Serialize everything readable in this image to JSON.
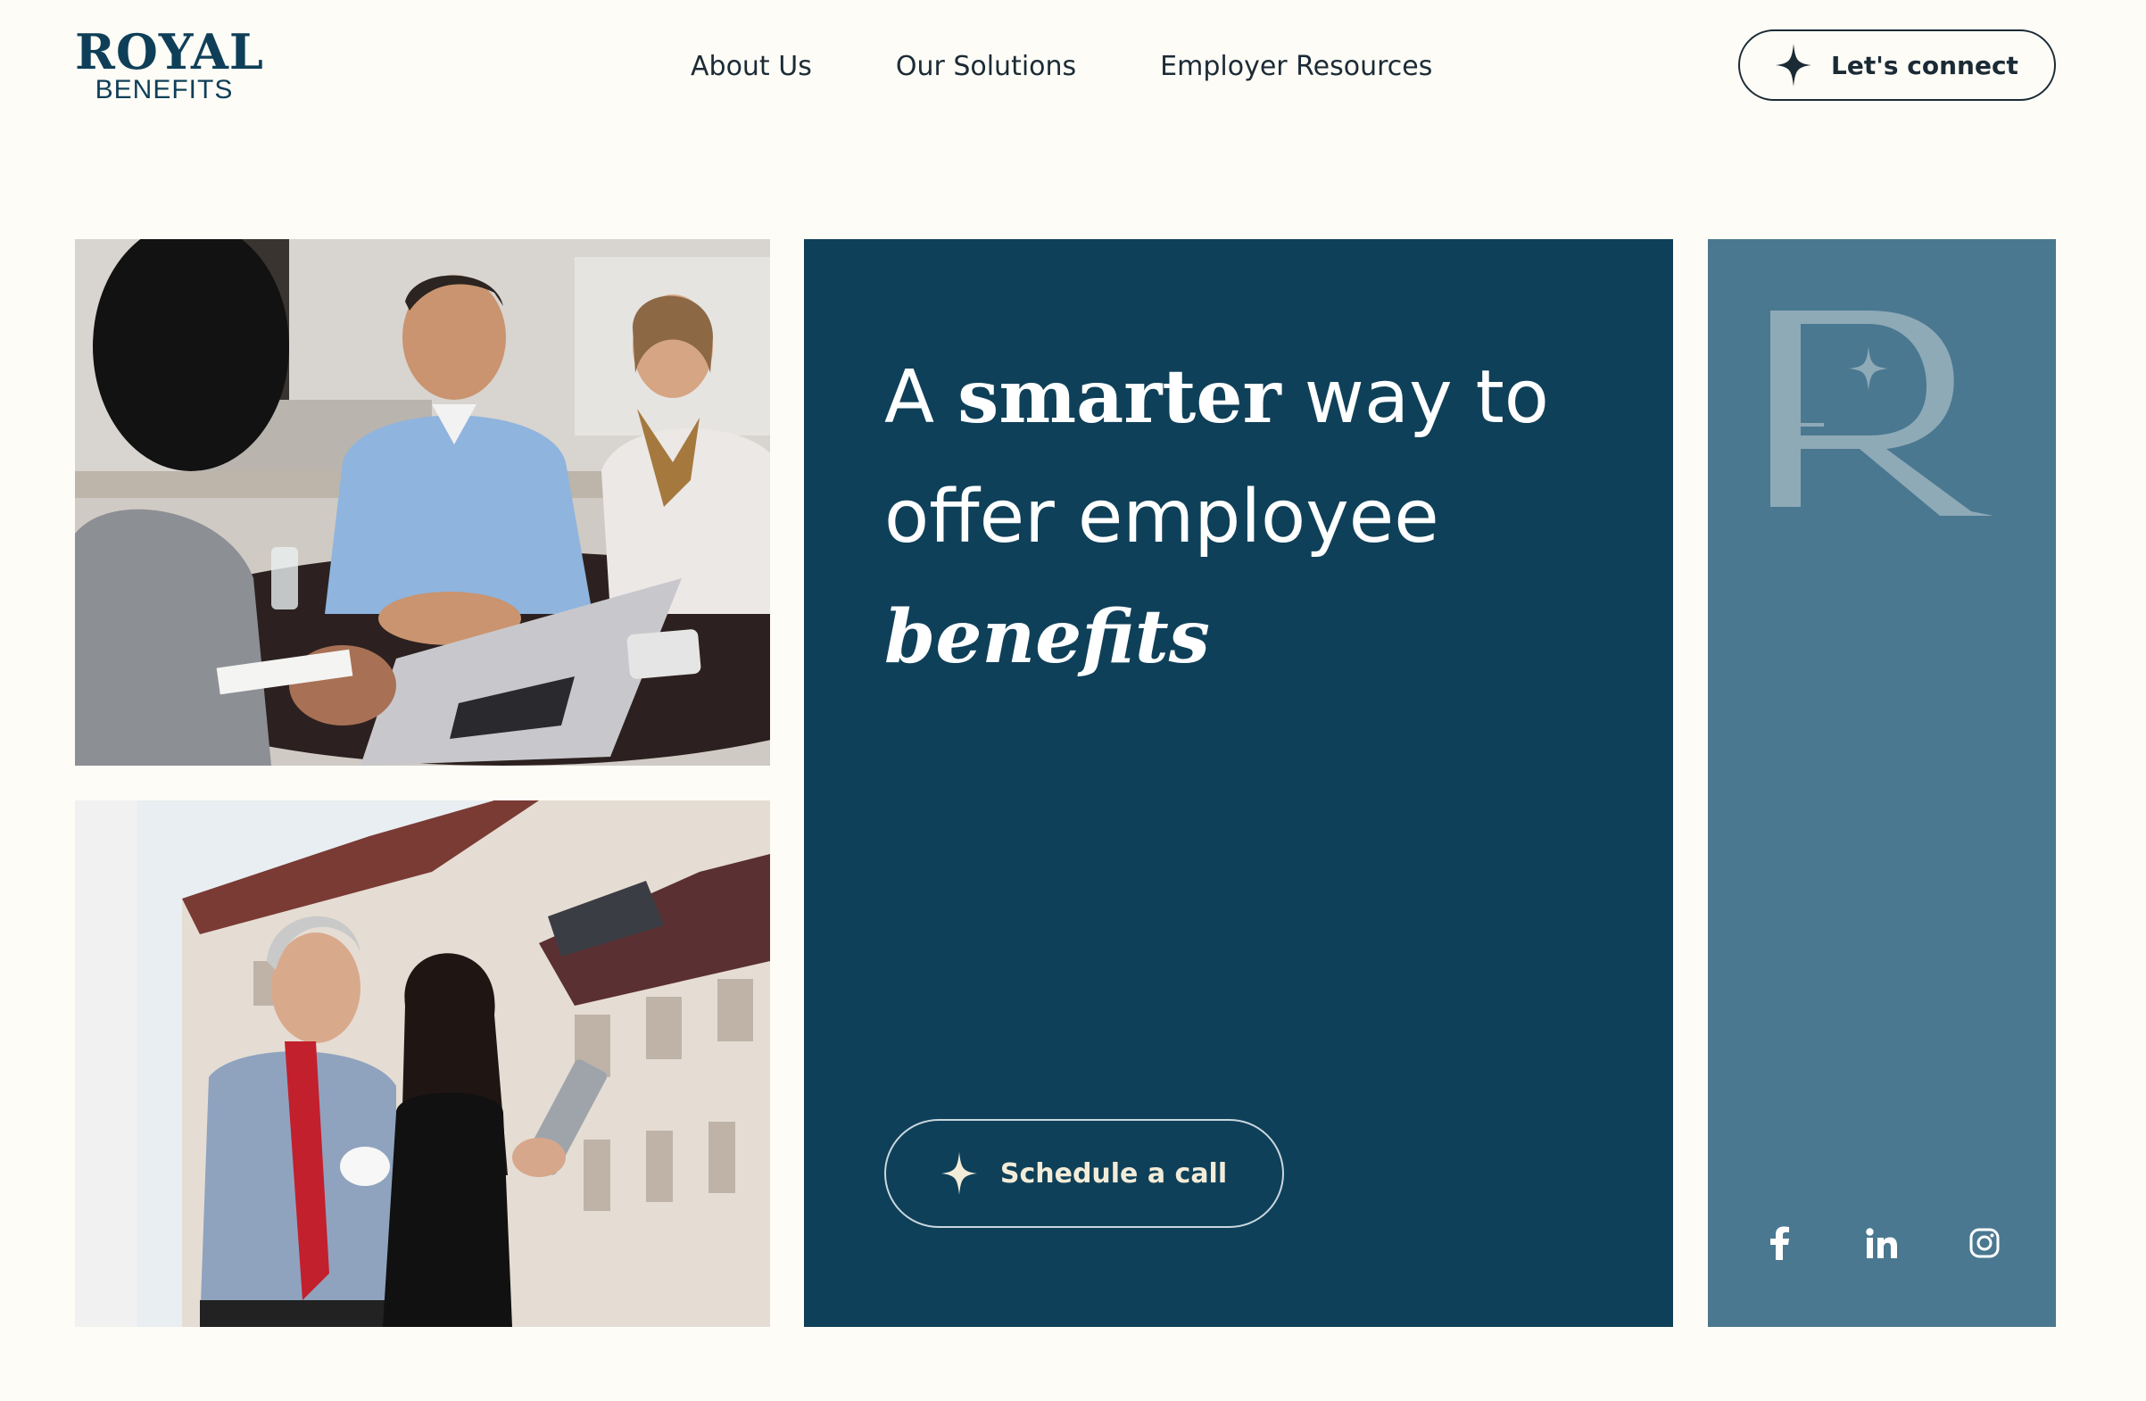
{
  "logo": {
    "top": "ROYAL",
    "bottom": "BENEFITS"
  },
  "nav": {
    "items": [
      {
        "label": "About Us"
      },
      {
        "label": "Our Solutions"
      },
      {
        "label": "Employer Resources"
      }
    ]
  },
  "header": {
    "cta_label": "Let's connect"
  },
  "hero": {
    "headline": {
      "part1": "A ",
      "part2": "smarter",
      "part3": " way to offer employee ",
      "part4": "benefits"
    },
    "cta_label": "Schedule a call"
  },
  "social": {
    "icons": [
      "facebook-icon",
      "linkedin-icon",
      "instagram-icon"
    ]
  },
  "colors": {
    "background": "#fdfcf6",
    "navy": "#0f4059",
    "slate_blue": "#4a7890",
    "cream": "#f3ecd8"
  }
}
